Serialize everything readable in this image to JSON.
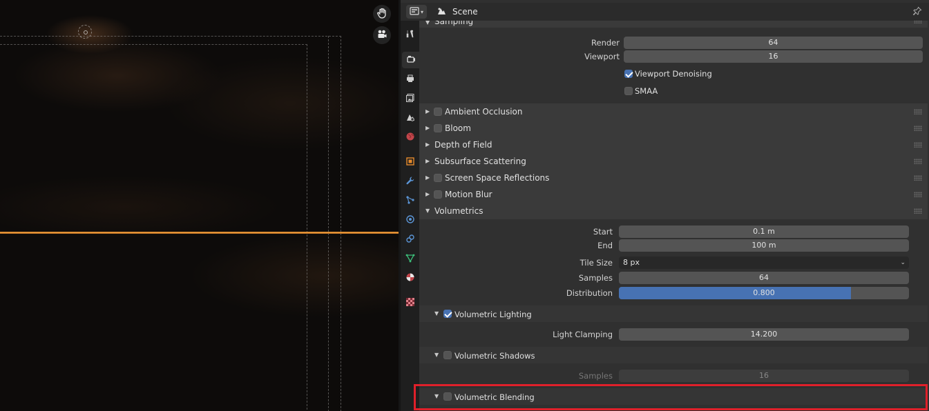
{
  "header": {
    "scene_label": "Scene",
    "accent": "#4772b3",
    "highlight_color": "#e0202a"
  },
  "tabs": [
    {
      "name": "tool-tab",
      "icon": "wrench-screwdriver-icon"
    },
    {
      "name": "render-tab",
      "icon": "camera-back-icon",
      "active": true
    },
    {
      "name": "output-tab",
      "icon": "printer-icon"
    },
    {
      "name": "view-layer-tab",
      "icon": "image-stack-icon"
    },
    {
      "name": "scene-tab",
      "icon": "scene-icon"
    },
    {
      "name": "world-tab",
      "icon": "world-icon"
    },
    {
      "name": "object-tab",
      "icon": "object-square-icon"
    },
    {
      "name": "modifier-tab",
      "icon": "wrench-icon"
    },
    {
      "name": "particles-tab",
      "icon": "particles-icon"
    },
    {
      "name": "physics-tab",
      "icon": "physics-icon"
    },
    {
      "name": "constraints-tab",
      "icon": "constraint-icon"
    },
    {
      "name": "data-tab",
      "icon": "mesh-data-icon"
    },
    {
      "name": "material-tab",
      "icon": "material-sphere-icon"
    },
    {
      "name": "texture-tab",
      "icon": "checker-texture-icon"
    }
  ],
  "sampling": {
    "title": "Sampling",
    "render_label": "Render",
    "render_value": "64",
    "viewport_label": "Viewport",
    "viewport_value": "16",
    "viewport_denoising_label": "Viewport Denoising",
    "viewport_denoising_checked": true,
    "smaa_label": "SMAA",
    "smaa_checked": false
  },
  "panels": {
    "ambient_occlusion": "Ambient Occlusion",
    "bloom": "Bloom",
    "depth_of_field": "Depth of Field",
    "subsurface_scattering": "Subsurface Scattering",
    "screen_space_reflections": "Screen Space Reflections",
    "motion_blur": "Motion Blur",
    "volumetrics": "Volumetrics"
  },
  "volumetrics": {
    "start_label": "Start",
    "start_value": "0.1 m",
    "end_label": "End",
    "end_value": "100 m",
    "tile_size_label": "Tile Size",
    "tile_size_value": "8 px",
    "samples_label": "Samples",
    "samples_value": "64",
    "distribution_label": "Distribution",
    "distribution_value": "0.800",
    "distribution_fraction": 0.8,
    "lighting_label": "Volumetric Lighting",
    "lighting_checked": true,
    "light_clamping_label": "Light Clamping",
    "light_clamping_value": "14.200",
    "shadows_label": "Volumetric Shadows",
    "shadows_checked": false,
    "shadow_samples_label": "Samples",
    "shadow_samples_value": "16",
    "blending_label": "Volumetric Blending",
    "blending_checked": false
  }
}
